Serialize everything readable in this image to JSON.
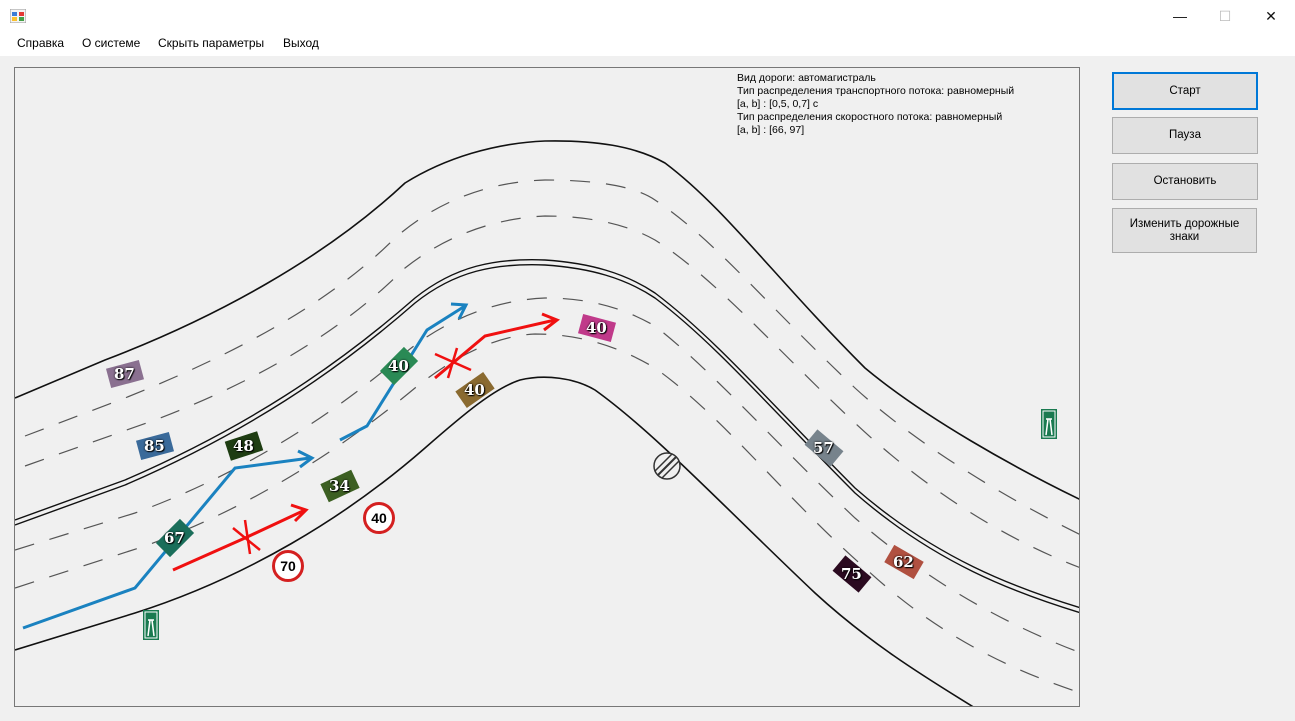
{
  "window": {
    "minimize": "—",
    "maximize": "☐",
    "close": "✕"
  },
  "menu": [
    "Справка",
    "О системе",
    "Скрыть параметры",
    "Выход"
  ],
  "info": [
    "Вид дороги: автомагистраль",
    "Тип распределения транспортного потока: равномерный",
    "[a, b] : [0,5,  0,7] c",
    "Тип распределения скоростного потока: равномерный",
    "[a, b] : [66,  97]"
  ],
  "buttons": {
    "start": "Старт",
    "pause": "Пауза",
    "stop": "Остановить",
    "change_signs": "Изменить дорожные знаки"
  },
  "cars": [
    {
      "label": "87",
      "color": "#8a7090"
    },
    {
      "label": "85",
      "color": "#3a6a9a"
    },
    {
      "label": "48",
      "color": "#1e3d12"
    },
    {
      "label": "40",
      "color": "#2a8a55"
    },
    {
      "label": "40",
      "color": "#c03a8a"
    },
    {
      "label": "40",
      "color": "#8a6a30"
    },
    {
      "label": "34",
      "color": "#3c5f22"
    },
    {
      "label": "67",
      "color": "#1a6e5a"
    },
    {
      "label": "57",
      "color": "#77838c"
    },
    {
      "label": "75",
      "color": "#2b0a20"
    },
    {
      "label": "62",
      "color": "#b05040"
    }
  ],
  "speed_signs": [
    "70",
    "40"
  ],
  "colors": {
    "lane_change_arrow": "#1a82c0",
    "blocked_arrow": "#f01010",
    "highway_sign": "#1a7a50",
    "speed_limit_ring": "#d42020"
  }
}
